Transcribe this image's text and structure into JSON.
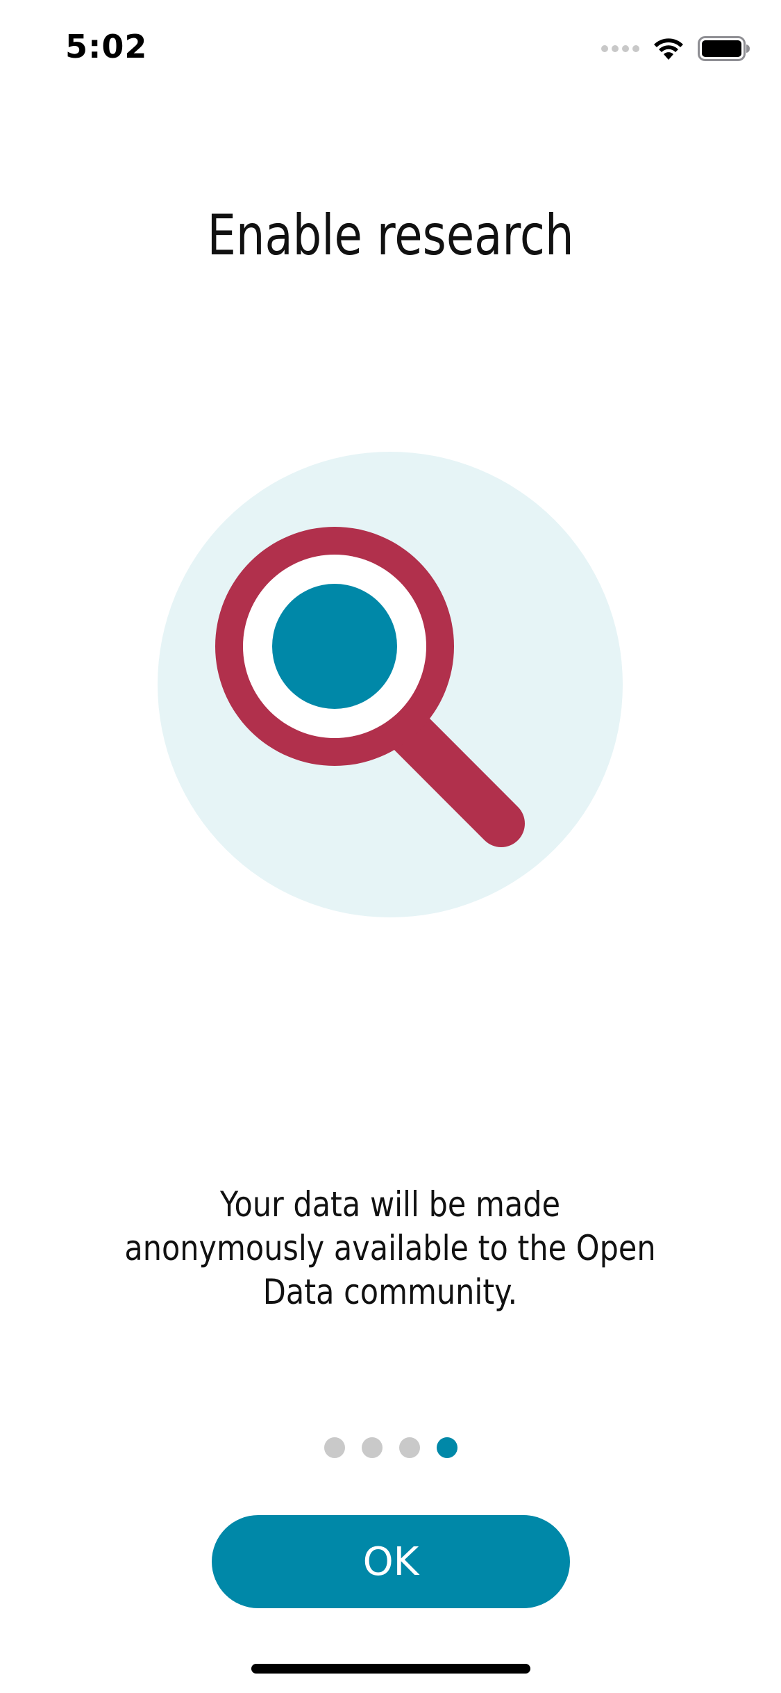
{
  "status_bar": {
    "time": "5:02",
    "icons": [
      "signal-dots-icon",
      "wifi-icon",
      "battery-icon"
    ]
  },
  "page": {
    "title": "Enable research",
    "description": "Your data will be made anonymously available to the Open Data community.",
    "illustration": "magnifying-glass-icon"
  },
  "pager": {
    "total": 4,
    "active_index": 3
  },
  "actions": {
    "ok_label": "OK"
  },
  "colors": {
    "accent": "#0088a8",
    "magnifier_ring": "#b1304c",
    "illustration_bg": "#e6f4f6",
    "inactive_dot": "#c9c9c9"
  }
}
